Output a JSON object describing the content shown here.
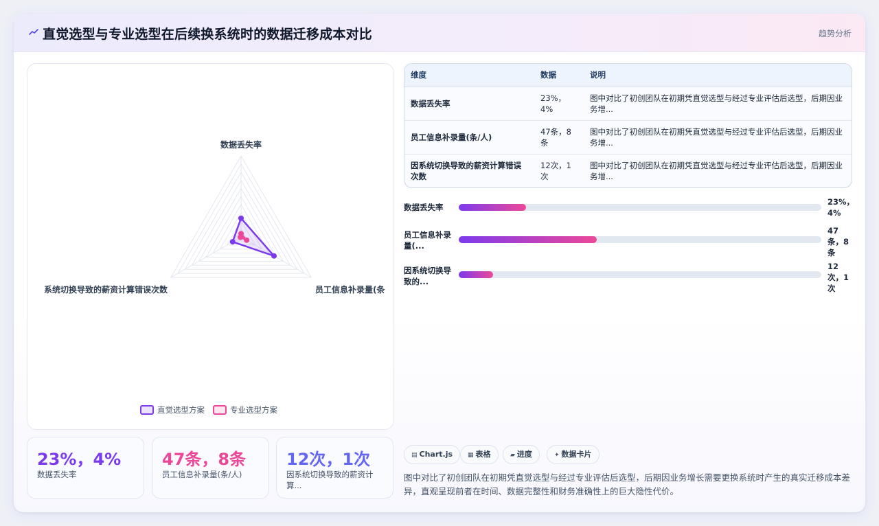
{
  "header": {
    "icon": "trend-line-icon",
    "title": "直觉选型与专业选型在后续换系统时的数据迁移成本对比",
    "action": "趋势分析"
  },
  "chart_data": {
    "type": "radar",
    "indicators": [
      "数据丢失率",
      "员工信息补录量(条/人)",
      "因系统切换导致的薪资计算错误次数"
    ],
    "visible_indicator_labels": [
      "数据丢失率",
      "员工信息补录量(条",
      "系统切换导致的薪资计算错误次数"
    ],
    "max": 100,
    "grid_levels": 10,
    "series": [
      {
        "name": "直觉选型方案",
        "values": [
          23,
          47,
          12
        ],
        "color": "#7c3aed"
      },
      {
        "name": "专业选型方案",
        "values": [
          4,
          8,
          1
        ],
        "color": "#ec4899"
      }
    ],
    "legend_position": "bottom-center"
  },
  "table": {
    "headers": [
      "维度",
      "数据",
      "说明"
    ],
    "rows": [
      {
        "dimension": "数据丢失率",
        "data": "23%，4%",
        "note": "图中对比了初创团队在初期凭直觉选型与经过专业评估后选型，后期因业务增..."
      },
      {
        "dimension": "员工信息补录量(条/人)",
        "data": "47条，8条",
        "note": "图中对比了初创团队在初期凭直觉选型与经过专业评估后选型，后期因业务增..."
      },
      {
        "dimension": "因系统切换导致的薪资计算错误次数",
        "data": "12次，1次",
        "note": "图中对比了初创团队在初期凭直觉选型与经过专业评估后选型，后期因业务增..."
      }
    ]
  },
  "progress": [
    {
      "label": "数据丢失率",
      "value": "23%，4%",
      "fill_percent": 18.5
    },
    {
      "label": "员工信息补录量(...",
      "value": "47条，8条",
      "fill_percent": 38
    },
    {
      "label": "因系统切换导致的...",
      "value": "12次，1次",
      "fill_percent": 9.5
    }
  ],
  "stats": [
    {
      "value": "23%，4%",
      "label": "数据丢失率",
      "color": "#7c3aed"
    },
    {
      "value": "47条，8条",
      "label": "员工信息补录量(条/人)",
      "color": "#ec4899"
    },
    {
      "value": "12次，1次",
      "label": "因系统切换导致的薪资计算...",
      "color": "#6366f1"
    }
  ],
  "chips": [
    {
      "icon": "chart-icon",
      "glyph": "▤",
      "label": "Chart.js"
    },
    {
      "icon": "table-icon",
      "glyph": "▦",
      "label": "表格"
    },
    {
      "icon": "progress-icon",
      "glyph": "▰",
      "label": "进度"
    },
    {
      "icon": "card-icon",
      "glyph": "✦",
      "label": "数据卡片"
    }
  ],
  "description": "图中对比了初创团队在初期凭直觉选型与经过专业评估后选型，后期因业务增长需要更换系统时产生的真实迁移成本差异，直观呈现前者在时间、数据完整性和财务准确性上的巨大隐性代价。"
}
